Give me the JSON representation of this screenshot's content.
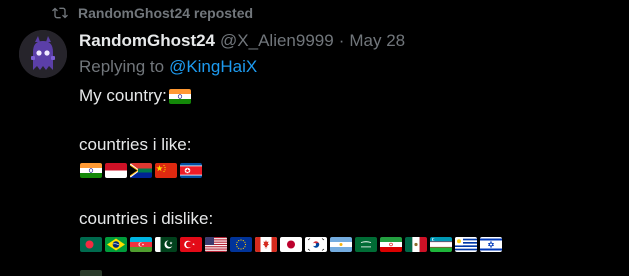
{
  "repost": {
    "text": "RandomGhost24 reposted",
    "icon": "repost-icon"
  },
  "post": {
    "display_name": "RandomGhost24",
    "handle": "@X_Alien9999",
    "separator": "·",
    "date": "May 28",
    "replying_prefix": "Replying to",
    "replying_mention": "@KingHaiX",
    "line1": "My country:",
    "line2": "countries i like:",
    "line3": "countries i dislike:",
    "my_country_flag": "India",
    "liked_flags": [
      "India",
      "Indonesia",
      "South Africa",
      "China",
      "North Korea"
    ],
    "disliked_flags": [
      "Bangladesh",
      "Brazil",
      "Azerbaijan",
      "Pakistan",
      "Turkey",
      "United States",
      "European Union",
      "Canada",
      "Japan",
      "South Korea",
      "Argentina",
      "Saudi Arabia",
      "Iran",
      "Mexico",
      "Uzbekistan",
      "Uruguay",
      "Israel"
    ]
  },
  "colors": {
    "background": "#000000",
    "primary_text": "#e7e9ea",
    "secondary_text": "#71767b",
    "mention": "#1d9bf0"
  }
}
